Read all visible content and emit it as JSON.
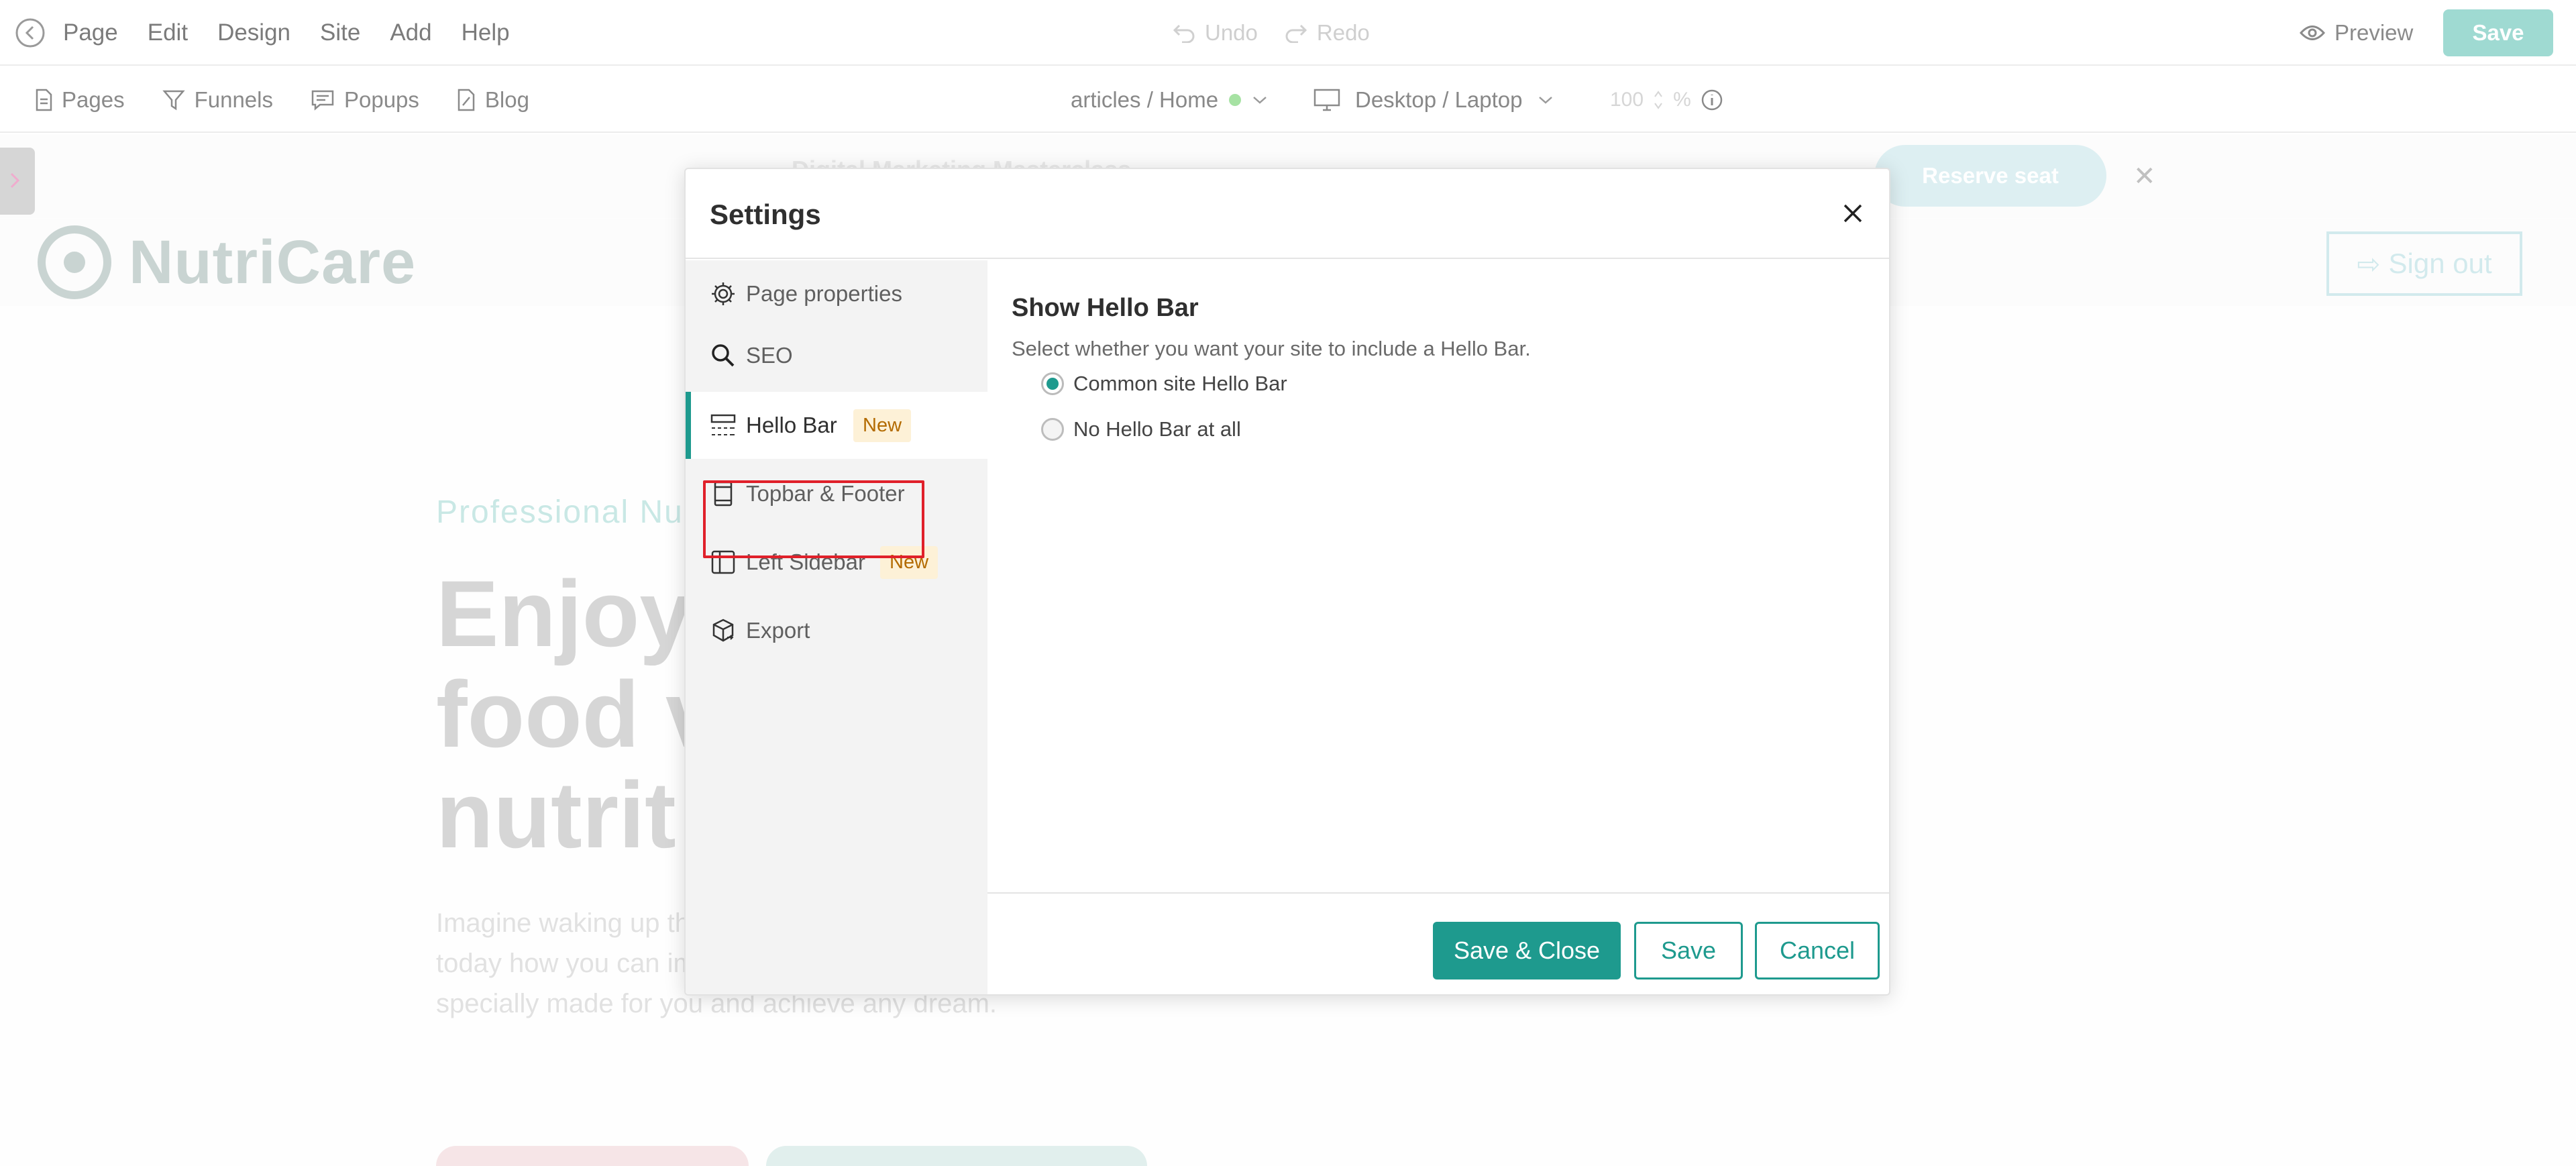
{
  "menubar": {
    "items": [
      "Page",
      "Edit",
      "Design",
      "Site",
      "Add",
      "Help"
    ],
    "undo": "Undo",
    "redo": "Redo",
    "preview": "Preview",
    "save": "Save"
  },
  "toolbar": {
    "pages": "Pages",
    "funnels": "Funnels",
    "popups": "Popups",
    "blog": "Blog",
    "breadcrumb": "articles / Home",
    "device": "Desktop / Laptop",
    "zoom": "100",
    "zoom_unit": "%"
  },
  "background": {
    "hellobar_button": "Reserve seat",
    "hellobar_text": "Digital Marketing Masterclass",
    "logo_name": "NutriCare",
    "signout": "Sign out",
    "hero_subtitle": "Professional Nu",
    "hero_title": [
      "Enjoy",
      "food v",
      "nutrit"
    ],
    "hero_body": "Imagine waking up the marathon you' intolerances better? Learn today how you can improve the way you eat, start a diet specially made for you and achieve any dream."
  },
  "modal": {
    "title": "Settings",
    "nav": [
      {
        "label": "Page properties",
        "badge": ""
      },
      {
        "label": "SEO",
        "badge": ""
      },
      {
        "label": "Hello Bar",
        "badge": "New"
      },
      {
        "label": "Topbar & Footer",
        "badge": ""
      },
      {
        "label": "Left Sidebar",
        "badge": "New"
      },
      {
        "label": "Export",
        "badge": ""
      }
    ],
    "content": {
      "title": "Show Hello Bar",
      "description": "Select whether you want your site to include a Hello Bar.",
      "options": [
        "Common site Hello Bar",
        "No Hello Bar at all"
      ],
      "selected": "Common site Hello Bar"
    },
    "footer": {
      "save_close": "Save & Close",
      "save": "Save",
      "cancel": "Cancel"
    }
  },
  "colors": {
    "accent": "#1e9a8e",
    "badge_bg": "#fdf1d7",
    "badge_text": "#b36b00",
    "highlight": "#e0202a"
  }
}
